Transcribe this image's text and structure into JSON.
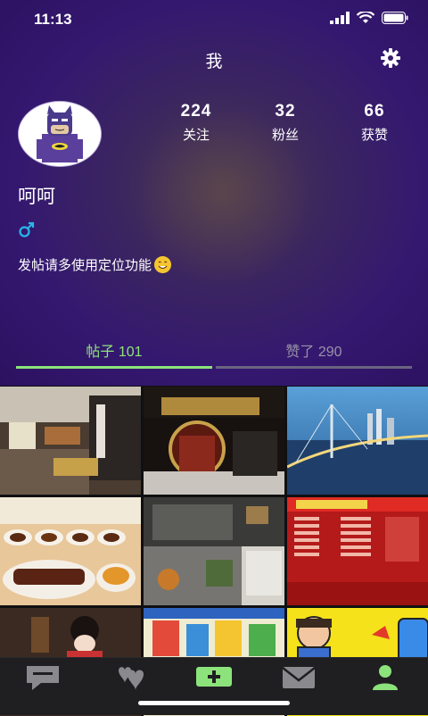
{
  "status_bar": {
    "time": "11:13"
  },
  "nav": {
    "title": "我"
  },
  "stats": [
    {
      "num": "224",
      "label": "关注"
    },
    {
      "num": "32",
      "label": "粉丝"
    },
    {
      "num": "66",
      "label": "获赞"
    }
  ],
  "profile": {
    "name": "呵呵",
    "bio": "发帖请多使用定位功能"
  },
  "tabs": [
    {
      "label": "帖子 101"
    },
    {
      "label": "赞了 290"
    }
  ],
  "colors": {
    "accent": "#8de37b",
    "header_purple": "#341870",
    "tab_inactive": "#9a93a8"
  },
  "icons": [
    "gear-icon",
    "male-icon",
    "smiley-icon",
    "chat-icon",
    "hearts-icon",
    "add-icon",
    "mail-icon",
    "profile-icon"
  ]
}
